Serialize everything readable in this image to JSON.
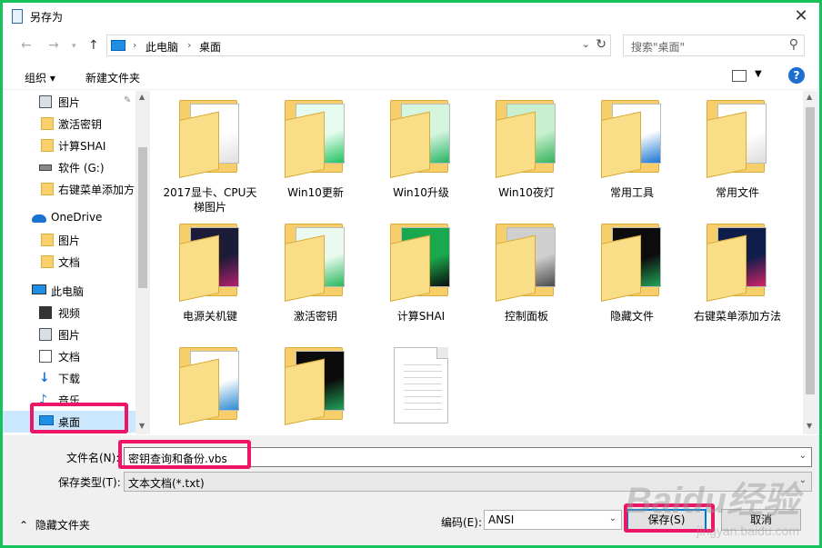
{
  "window": {
    "title": "另存为"
  },
  "address": {
    "crumbs": [
      "此电脑",
      "桌面"
    ]
  },
  "search": {
    "placeholder": "搜索\"桌面\""
  },
  "toolbar": {
    "organize": "组织 ▾",
    "new_folder": "新建文件夹",
    "help": "?"
  },
  "sidebar": {
    "items": [
      {
        "label": "图片",
        "icon": "pictures-icon"
      },
      {
        "label": "激活密钥",
        "icon": "folder-icon"
      },
      {
        "label": "计算SHAI",
        "icon": "folder-icon"
      },
      {
        "label": "软件 (G:)",
        "icon": "drive-icon"
      },
      {
        "label": "右键菜单添加方法",
        "icon": "folder-icon"
      },
      {
        "label": "OneDrive",
        "icon": "onedrive-icon"
      },
      {
        "label": "图片",
        "icon": "folder-icon"
      },
      {
        "label": "文档",
        "icon": "folder-icon"
      },
      {
        "label": "此电脑",
        "icon": "pc-icon"
      },
      {
        "label": "视频",
        "icon": "video-icon"
      },
      {
        "label": "图片",
        "icon": "pictures-icon"
      },
      {
        "label": "文档",
        "icon": "document-icon"
      },
      {
        "label": "下载",
        "icon": "download-icon"
      },
      {
        "label": "音乐",
        "icon": "music-icon"
      },
      {
        "label": "桌面",
        "icon": "desktop-icon"
      }
    ]
  },
  "files": [
    {
      "name": "2017显卡、CPU天梯图片",
      "kind": "folder",
      "preview": [
        "#ffffff",
        "#e0e0e0"
      ]
    },
    {
      "name": "Win10更新",
      "kind": "folder",
      "preview": [
        "#e6fbef",
        "#1fc25e"
      ]
    },
    {
      "name": "Win10升级",
      "kind": "folder",
      "preview": [
        "#d4f5de",
        "#28b463"
      ]
    },
    {
      "name": "Win10夜灯",
      "kind": "folder",
      "preview": [
        "#c8f0d0",
        "#36b35a"
      ]
    },
    {
      "name": "常用工具",
      "kind": "folder",
      "preview": [
        "#ffffff",
        "#1976d2"
      ]
    },
    {
      "name": "常用文件",
      "kind": "folder",
      "preview": [
        "#ffffff",
        "#dddddd"
      ]
    },
    {
      "name": "电源关机键",
      "kind": "folder",
      "preview": [
        "#1b1b3a",
        "#b31f6e"
      ]
    },
    {
      "name": "激活密钥",
      "kind": "folder",
      "preview": [
        "#eafaf0",
        "#26b85a"
      ]
    },
    {
      "name": "计算SHAI",
      "kind": "folder",
      "preview": [
        "#1aa84f",
        "#0b0b0b"
      ]
    },
    {
      "name": "控制面板",
      "kind": "folder",
      "preview": [
        "#cfcfcf",
        "#4a4a4a"
      ]
    },
    {
      "name": "隐藏文件",
      "kind": "folder",
      "preview": [
        "#0c0c0c",
        "#22a35a"
      ]
    },
    {
      "name": "右键菜单添加方法",
      "kind": "folder",
      "preview": [
        "#0e1d4a",
        "#d22468"
      ]
    },
    {
      "name": "",
      "kind": "folder",
      "preview": [
        "#ffffff",
        "#2a8ad1"
      ]
    },
    {
      "name": "",
      "kind": "folder",
      "preview": [
        "#0b0b0b",
        "#22a35a"
      ]
    },
    {
      "name": "",
      "kind": "document",
      "preview": [
        "#ffffff",
        "#d4d4d4"
      ]
    }
  ],
  "form": {
    "filename_label": "文件名(N):",
    "filename_value": "密钥查询和备份.vbs",
    "type_label": "保存类型(T):",
    "type_value": "文本文档(*.txt)",
    "hide_folders": "隐藏文件夹",
    "encoding_label": "编码(E):",
    "encoding_value": "ANSI",
    "save": "保存(S)",
    "cancel": "取消"
  },
  "watermark": {
    "logo": "Baidu经验",
    "url": "jingyan.baidu.com"
  },
  "colors": {
    "border": "#16c25a",
    "highlight": "#ee1466",
    "selected": "#cce8ff"
  }
}
